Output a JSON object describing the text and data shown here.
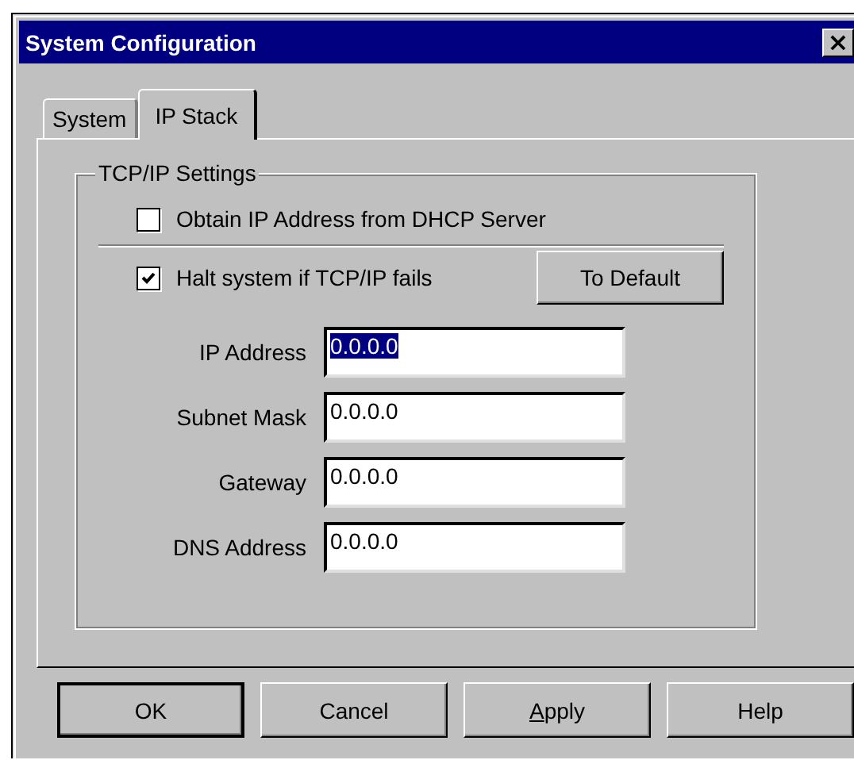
{
  "window": {
    "title": "System Configuration",
    "close_label": "×"
  },
  "tabs": [
    {
      "label": "System",
      "selected": false
    },
    {
      "label": "IP Stack",
      "selected": true
    }
  ],
  "group": {
    "title": "TCP/IP Settings",
    "checkboxes": [
      {
        "label": "Obtain IP Address from DHCP Server",
        "checked": false
      },
      {
        "label": "Halt system if TCP/IP fails",
        "checked": true
      }
    ],
    "default_button": "To Default",
    "fields": [
      {
        "label": "IP Address",
        "value": "0.0.0.0",
        "selected": true
      },
      {
        "label": "Subnet Mask",
        "value": "0.0.0.0",
        "selected": false
      },
      {
        "label": "Gateway",
        "value": "0.0.0.0",
        "selected": false
      },
      {
        "label": "DNS Address",
        "value": "0.0.0.0",
        "selected": false
      }
    ]
  },
  "buttons": [
    {
      "label": "OK",
      "underlined_first": false,
      "default": true
    },
    {
      "label": "Cancel",
      "underlined_first": false,
      "default": false
    },
    {
      "label": "Apply",
      "underlined_first": true,
      "default": false
    },
    {
      "label": "Help",
      "underlined_first": false,
      "default": false
    }
  ]
}
